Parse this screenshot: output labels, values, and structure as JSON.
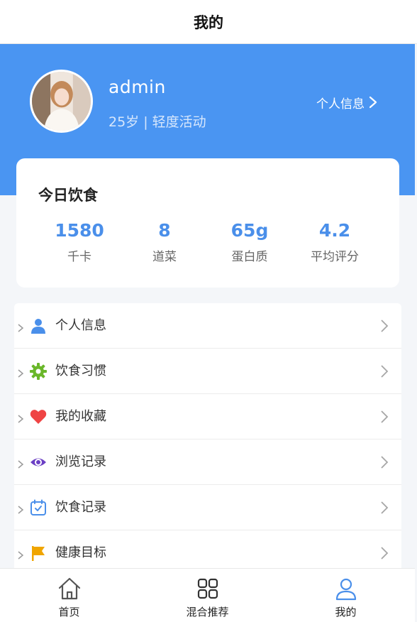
{
  "header": {
    "title": "我的"
  },
  "profile": {
    "username": "admin",
    "subtitle": "25岁 | 轻度活动",
    "link_label": "个人信息"
  },
  "today": {
    "title": "今日饮食",
    "stats": [
      {
        "value": "1580",
        "label": "千卡"
      },
      {
        "value": "8",
        "label": "道菜"
      },
      {
        "value": "65g",
        "label": "蛋白质"
      },
      {
        "value": "4.2",
        "label": "平均评分"
      }
    ]
  },
  "menu": {
    "items": [
      {
        "label": "个人信息",
        "icon": "user-icon",
        "color": "#4a8fea"
      },
      {
        "label": "饮食习惯",
        "icon": "gear-icon",
        "color": "#6ab72a"
      },
      {
        "label": "我的收藏",
        "icon": "heart-icon",
        "color": "#ef4444"
      },
      {
        "label": "浏览记录",
        "icon": "eye-icon",
        "color": "#6b3fc4"
      },
      {
        "label": "饮食记录",
        "icon": "calendar-icon",
        "color": "#4a8fea"
      },
      {
        "label": "健康目标",
        "icon": "flag-icon",
        "color": "#f0a500"
      }
    ]
  },
  "tabbar": {
    "tabs": [
      {
        "label": "首页",
        "icon": "home-icon"
      },
      {
        "label": "混合推荐",
        "icon": "grid-icon"
      },
      {
        "label": "我的",
        "icon": "profile-icon",
        "active": true
      }
    ]
  },
  "colors": {
    "accent": "#4a95f2",
    "stat_value": "#4a8fea"
  }
}
